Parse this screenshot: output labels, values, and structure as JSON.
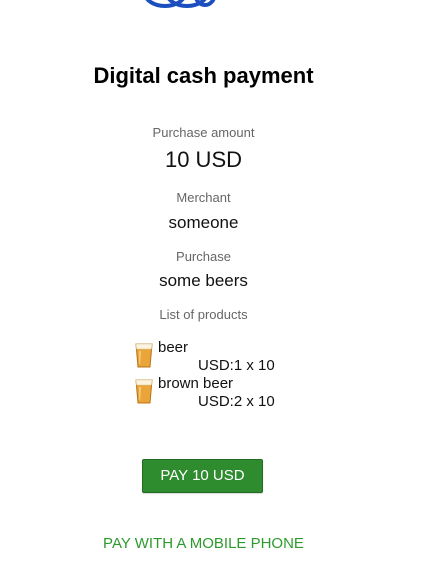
{
  "header": {
    "logo_icon": "bank-logo-icon",
    "logo_color": "#1b4fbf",
    "title": "Digital cash payment"
  },
  "payment": {
    "amount_label": "Purchase amount",
    "amount_value": "10 USD",
    "merchant_label": "Merchant",
    "merchant_value": "someone",
    "purchase_label": "Purchase",
    "purchase_value": "some beers"
  },
  "products": {
    "label": "List of products",
    "items": [
      {
        "icon": "beer-glass-icon",
        "name": "beer",
        "price": "USD:1 x 10"
      },
      {
        "icon": "beer-glass-icon",
        "name": "brown beer",
        "price": "USD:2 x 10"
      }
    ]
  },
  "actions": {
    "pay_label": "PAY 10 USD",
    "mobile_label": "PAY WITH A MOBILE PHONE"
  },
  "colors": {
    "button_bg": "#2e8b2e",
    "link": "#2e9a2e",
    "label_gray": "#666666"
  }
}
